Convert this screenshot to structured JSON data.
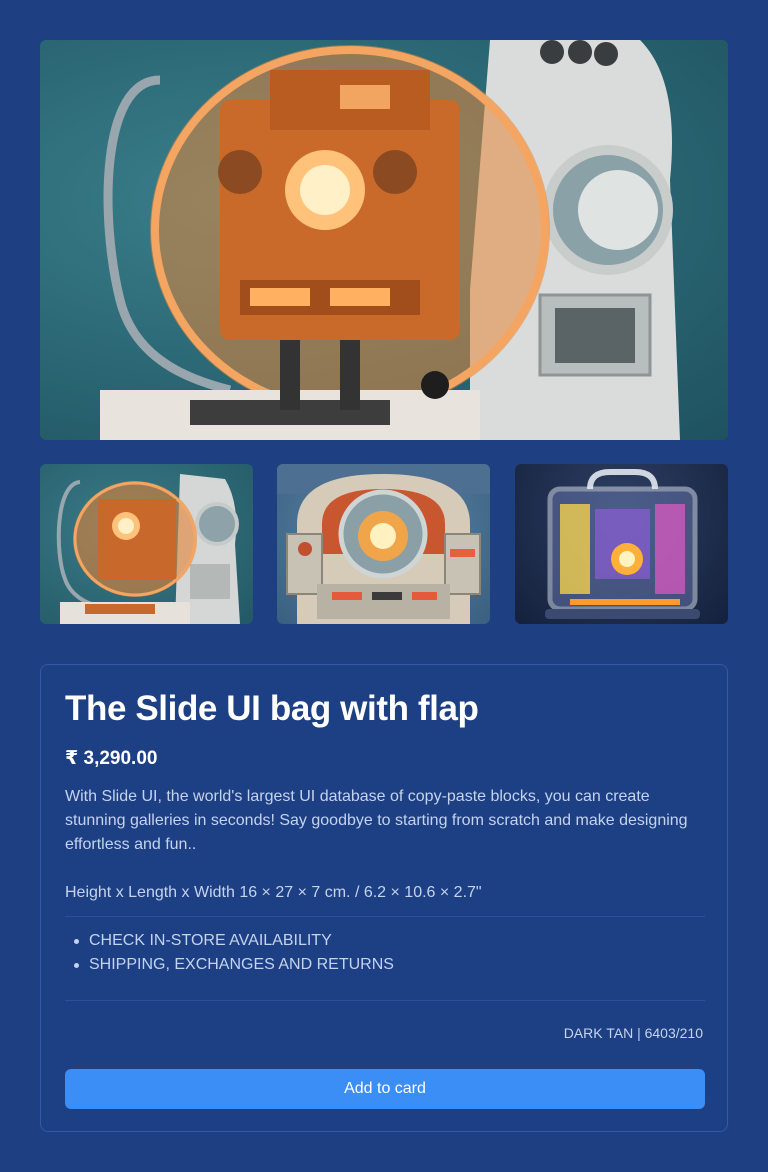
{
  "gallery": {
    "main_image": "retro-robot-orange-dome",
    "thumbnails": [
      "retro-robot-orange-dome",
      "retro-arcade-console-robot",
      "neon-transparent-case-robot"
    ]
  },
  "product": {
    "title": "The Slide UI bag with flap",
    "price": "₹ 3,290.00",
    "description": "With Slide UI, the world's largest UI database of copy-paste blocks, you can create stunning galleries in seconds! Say goodbye to starting from scratch and make designing effortless and fun..",
    "dimensions": "Height x Length x Width 16 × 27 × 7 cm. / 6.2 × 10.6 × 2.7\"",
    "links": [
      "CHECK IN-STORE AVAILABILITY",
      "SHIPPING, EXCHANGES AND RETURNS"
    ],
    "sku": "DARK TAN | 6403/210",
    "add_button_label": "Add to card"
  },
  "colors": {
    "background": "#1e3f82",
    "button": "#3b8ef5",
    "text_muted": "#c5d3ee"
  }
}
